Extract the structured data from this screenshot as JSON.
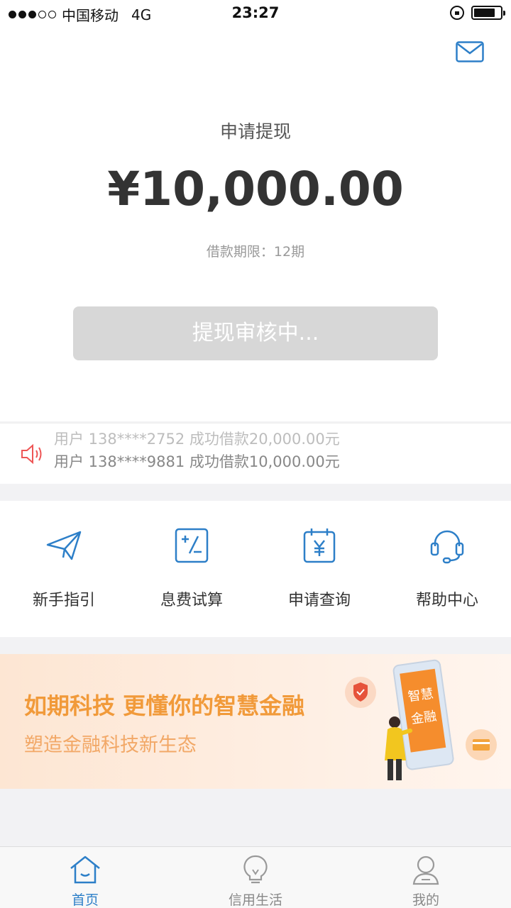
{
  "status_bar": {
    "carrier": "中国移动",
    "network": "4G",
    "time": "23:27"
  },
  "hero": {
    "title": "申请提现",
    "amount": "¥10,000.00",
    "term": "借款期限：12期",
    "status_button": "提现审核中..."
  },
  "ticker": {
    "lines": [
      "用户 138****2752 成功借款20,000.00元",
      "用户 138****9881 成功借款10,000.00元"
    ]
  },
  "menu": {
    "items": [
      {
        "label": "新手指引",
        "icon": "paper-plane-icon"
      },
      {
        "label": "息费试算",
        "icon": "calculator-icon"
      },
      {
        "label": "申请查询",
        "icon": "calendar-yen-icon"
      },
      {
        "label": "帮助中心",
        "icon": "headset-icon"
      }
    ]
  },
  "banner": {
    "title": "如期科技 更懂你的智慧金融",
    "subtitle": "塑造金融科技新生态",
    "phone_text": "智慧金融"
  },
  "tabbar": {
    "items": [
      {
        "label": "首页",
        "icon": "home-icon",
        "active": true
      },
      {
        "label": "信用生活",
        "icon": "lightbulb-icon",
        "active": false
      },
      {
        "label": "我的",
        "icon": "user-icon",
        "active": false
      }
    ]
  },
  "colors": {
    "accent": "#2d7fc8",
    "banner_orange": "#f19a3a",
    "button_disabled": "#d7d7d7"
  }
}
